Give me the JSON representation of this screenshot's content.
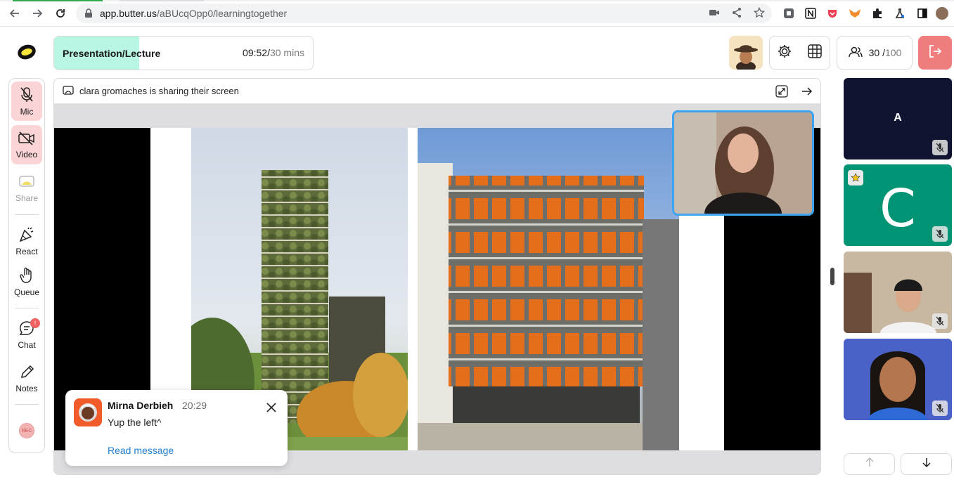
{
  "browser": {
    "url_host": "app.butter.us",
    "url_path": "/aBUcqOpp0/learningtogether"
  },
  "session": {
    "title": "Presentation/Lecture",
    "elapsed": "09:52/",
    "total": "30 mins",
    "progress": 0.33
  },
  "header": {
    "people_count": "30",
    "people_sep": " /",
    "people_max": "100"
  },
  "toolbar": {
    "mic": "Mic",
    "video": "Video",
    "share": "Share",
    "react": "React",
    "queue": "Queue",
    "chat": "Chat",
    "chat_badge": "!",
    "notes": "Notes",
    "rec": "REC"
  },
  "share": {
    "status": "clara gromaches is sharing their screen"
  },
  "toast": {
    "name": "Mirna Derbieh",
    "time": "20:29",
    "message": "Yup the left^",
    "action": "Read message"
  },
  "participants": {
    "tile_a_letter": "A",
    "tile_c_letter": "C"
  },
  "colors": {
    "accent_teal": "#b9f5e3",
    "leave_red": "#f07d7d",
    "speaker_border": "#3ea4f0",
    "link_blue": "#1f7fd0"
  }
}
